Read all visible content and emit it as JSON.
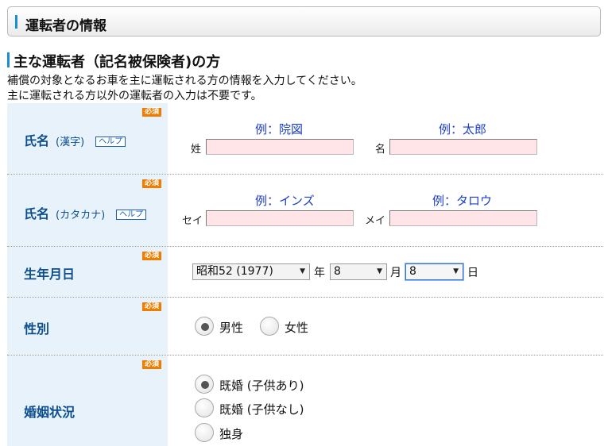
{
  "section_title": "運転者の情報",
  "subsection_title": "主な運転者（記名被保険者)の方",
  "description_line1": "補償の対象となるお車を主に運転される方の情報を入力してください。",
  "description_line2": "主に運転される方以外の運転者の入力は不要です。",
  "required_badge": "必須",
  "help_label": "ヘルプ",
  "colors": {
    "accent": "#1a8ed6",
    "label_bg": "#e8f2fa",
    "label_text": "#0d4e8e",
    "required": "#f07d00",
    "input_bg": "#ffe4e8",
    "example_text": "#1a3dc8"
  },
  "name_kanji": {
    "label": "氏名",
    "sub": "(漢字)",
    "last_prefix": "姓",
    "first_prefix": "名",
    "last_example": "例：院図",
    "first_example": "例：太郎",
    "last_value": "",
    "first_value": ""
  },
  "name_kana": {
    "label": "氏名",
    "sub": "(カタカナ)",
    "last_prefix": "セイ",
    "first_prefix": "メイ",
    "last_example": "例：インズ",
    "first_example": "例：タロウ",
    "last_value": "",
    "first_value": ""
  },
  "birthdate": {
    "label": "生年月日",
    "year_value": "昭和52 (1977)",
    "year_unit": "年",
    "month_value": "8",
    "month_unit": "月",
    "day_value": "8",
    "day_unit": "日"
  },
  "gender": {
    "label": "性別",
    "options": [
      {
        "label": "男性",
        "selected": true
      },
      {
        "label": "女性",
        "selected": false
      }
    ]
  },
  "marital": {
    "label": "婚姻状況",
    "options": [
      {
        "label": "既婚 (子供あり)",
        "selected": true
      },
      {
        "label": "既婚 (子供なし)",
        "selected": false
      },
      {
        "label": "独身",
        "selected": false
      }
    ]
  }
}
